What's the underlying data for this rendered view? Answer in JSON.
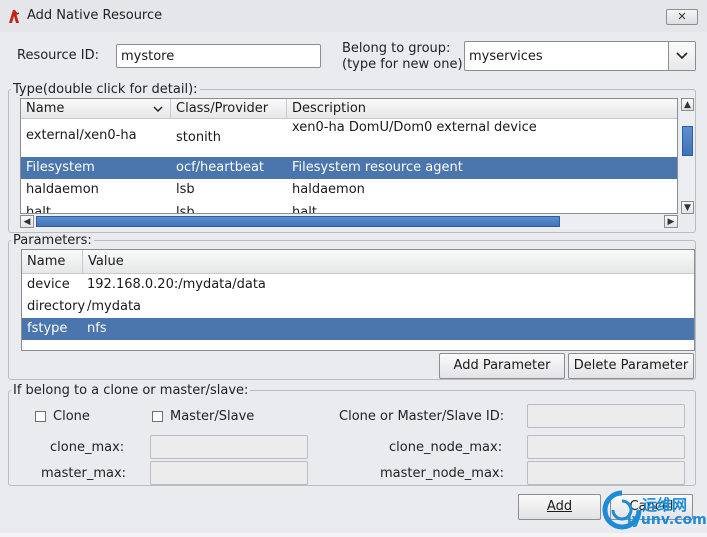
{
  "window": {
    "title": "Add Native Resource",
    "close_label": "✕"
  },
  "resource_id": {
    "label": "Resource ID:",
    "value": "mystore"
  },
  "group": {
    "label_line1": "Belong to group:",
    "label_line2": "(type for new one)",
    "value": "myservices"
  },
  "type_section": {
    "title": "Type(double click for detail):",
    "columns": [
      "Name",
      "Class/Provider",
      "Description"
    ],
    "rows": [
      {
        "name": "external/xen0-ha",
        "provider": "stonith",
        "description": "xen0-ha DomU/Dom0 external device"
      },
      {
        "name": "Filesystem",
        "provider": "ocf/heartbeat",
        "description": "Filesystem resource agent"
      },
      {
        "name": "haldaemon",
        "provider": "lsb",
        "description": "haldaemon"
      },
      {
        "name": "halt",
        "provider": "lsb",
        "description": "halt"
      }
    ],
    "selected_row": 1
  },
  "parameters": {
    "title": "Parameters:",
    "columns": [
      "Name",
      "Value"
    ],
    "rows": [
      {
        "name": "device",
        "value": "192.168.0.20:/mydata/data"
      },
      {
        "name": "directory",
        "value": "/mydata"
      },
      {
        "name": "fstype",
        "value": "nfs"
      }
    ],
    "selected_row": 2,
    "add_label": "Add Parameter",
    "delete_label": "Delete Parameter"
  },
  "clone_section": {
    "title": "If belong to a clone or master/slave:",
    "clone_label": "Clone",
    "clone_checked": false,
    "master_slave_label": "Master/Slave",
    "master_slave_checked": false,
    "clone_id_label": "Clone or Master/Slave ID:",
    "clone_max_label": "clone_max:",
    "clone_node_max_label": "clone_node_max:",
    "master_max_label": "master_max:",
    "master_node_max_label": "master_node_max:"
  },
  "footer": {
    "add_label": "Add",
    "cancel_label": "Cancel"
  },
  "watermark": {
    "text1": "运维网",
    "text2": "iyunv.com"
  },
  "colors": {
    "selection": "#4a76ad",
    "scroll_thumb": "#4a7fc4",
    "watermark": "#1d8bd6"
  }
}
